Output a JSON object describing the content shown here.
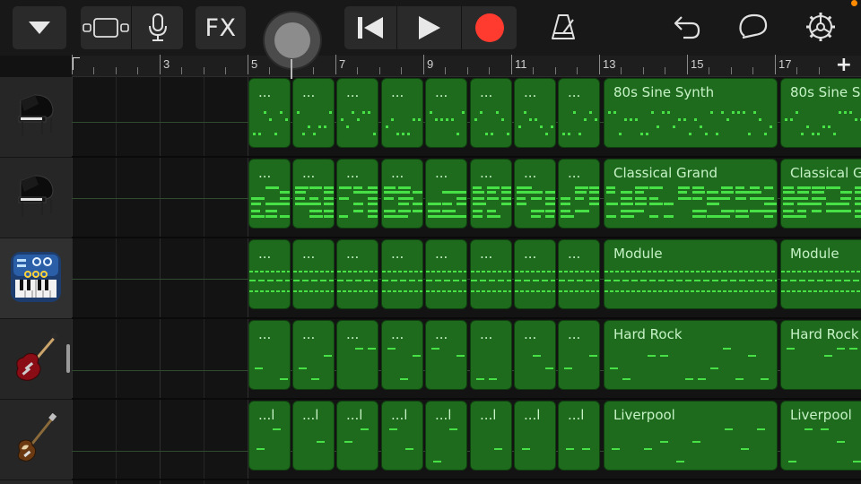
{
  "toolbar": {
    "browser_icon": "chevron-down-icon",
    "tracks_view_icon": "tracks-view-icon",
    "mic_icon": "microphone-icon",
    "fx_label": "FX",
    "rewind_icon": "skip-back-icon",
    "play_icon": "play-icon",
    "record_icon": "record-icon",
    "metronome_icon": "metronome-icon",
    "undo_icon": "undo-icon",
    "loop_icon": "loop-icon",
    "settings_icon": "gear-icon",
    "master_volume_icon": "volume-knob-icon",
    "record_color": "#ff3b30",
    "notification_dot_color": "#ff8a00"
  },
  "ruler": {
    "bar_numbers": [
      "3",
      "5",
      "7",
      "9",
      "11",
      "13",
      "15",
      "17"
    ],
    "add_label": "+"
  },
  "tracks": [
    {
      "icon": "grand-piano-icon",
      "instrument": "80s Sine Synth"
    },
    {
      "icon": "grand-piano-icon",
      "instrument": "Classical Grand"
    },
    {
      "icon": "synth-module-icon",
      "instrument": "Module"
    },
    {
      "icon": "electric-guitar-icon",
      "instrument": "Hard Rock"
    },
    {
      "icon": "bass-guitar-icon",
      "instrument": "Liverpool"
    }
  ],
  "regions": {
    "short_labels": [
      "...",
      "...",
      "...",
      "...",
      "...l"
    ],
    "long_labels": [
      "80s Sine Synth",
      "Classical Grand",
      "Module",
      "Hard Rock",
      "Liverpool"
    ]
  },
  "colors": {
    "region_fill": "#1e6b1e",
    "note_color": "#47e047"
  }
}
